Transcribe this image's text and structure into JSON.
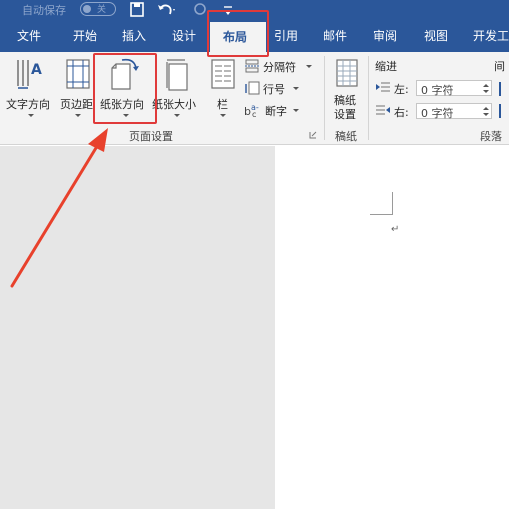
{
  "titlebar": {
    "autosave_label": "自动保存",
    "autosave_state": "关"
  },
  "tabs": [
    {
      "label": "文件"
    },
    {
      "label": "开始"
    },
    {
      "label": "插入"
    },
    {
      "label": "设计"
    },
    {
      "label": "布局",
      "active": true
    },
    {
      "label": "引用"
    },
    {
      "label": "邮件"
    },
    {
      "label": "审阅"
    },
    {
      "label": "视图"
    },
    {
      "label": "开发工"
    }
  ],
  "ribbon": {
    "page_setup": {
      "group_label": "页面设置",
      "text_direction": "文字方向",
      "margins": "页边距",
      "orientation": "纸张方向",
      "size": "纸张大小",
      "columns": "栏",
      "breaks": "分隔符",
      "line_numbers": "行号",
      "hyphenation": "断字"
    },
    "manuscript": {
      "group_label": "稿纸",
      "button_line1": "稿纸",
      "button_line2": "设置"
    },
    "paragraph": {
      "indent_label": "缩进",
      "spacing_label": "间",
      "left_label": "左:",
      "left_value": "0 字符",
      "right_label": "右:",
      "right_value": "0 字符",
      "group_label": "段落"
    }
  },
  "document": {
    "paragraph_mark": "↵"
  },
  "colors": {
    "brand": "#2b579a",
    "ribbon_bg": "#f3f3f3",
    "annotation": "#e03a3a"
  },
  "icons": [
    "save-icon",
    "undo-icon",
    "redo-icon",
    "customize-quick-access-icon",
    "text-direction-icon",
    "margins-icon",
    "orientation-icon",
    "paper-size-icon",
    "columns-icon",
    "breaks-icon",
    "line-numbers-icon",
    "hyphenation-icon",
    "manuscript-icon",
    "indent-left-icon",
    "indent-right-icon",
    "dialog-launcher-icon"
  ]
}
